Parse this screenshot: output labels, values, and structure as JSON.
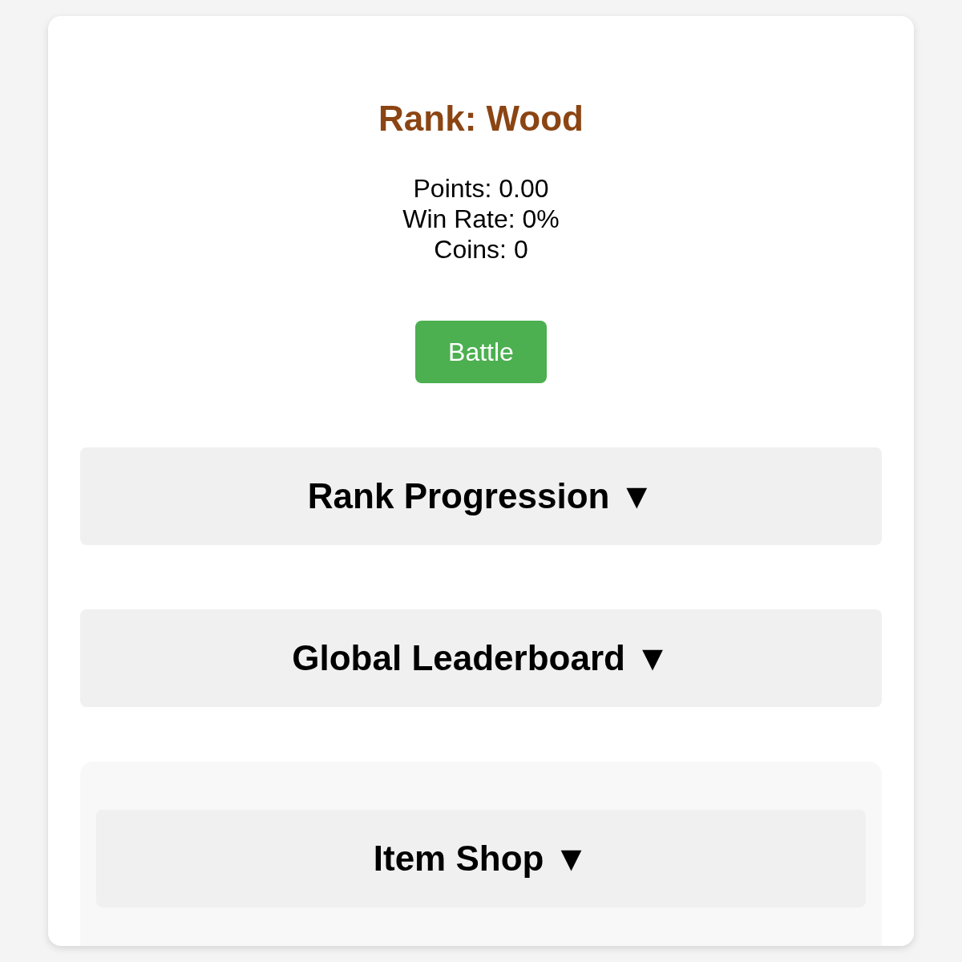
{
  "rank": {
    "title": "Rank: Wood",
    "stats": [
      "Points: 0.00",
      "Win Rate: 0%",
      "Coins: 0"
    ],
    "battle_button": "Battle"
  },
  "sections": [
    {
      "title": "Rank Progression ▼"
    },
    {
      "title": "Global Leaderboard ▼"
    }
  ],
  "shop_panel": {
    "title": "Item Shop ▼"
  }
}
